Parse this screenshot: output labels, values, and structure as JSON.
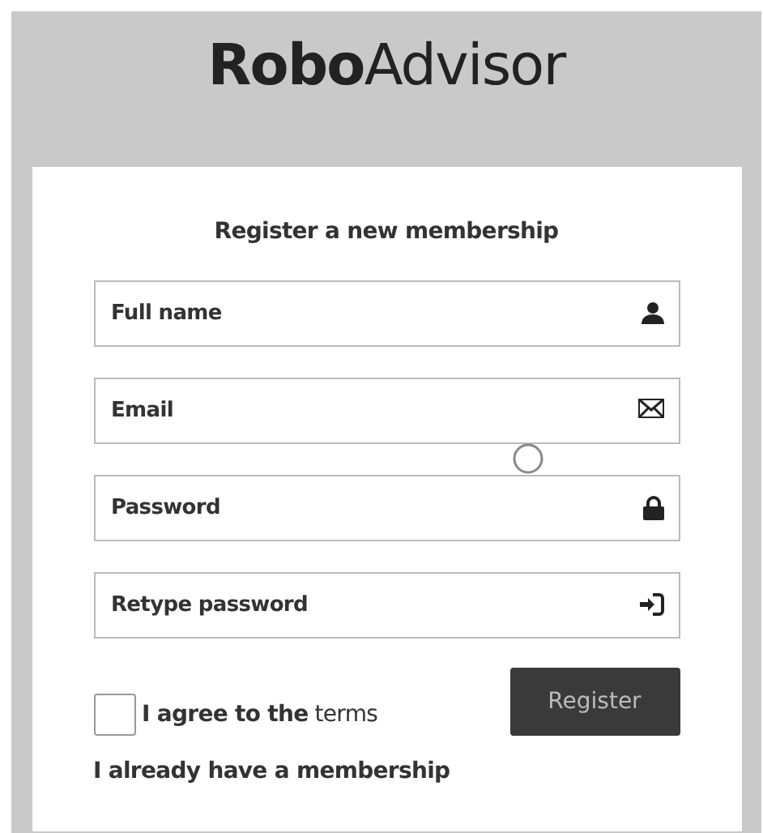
{
  "logo": "**Robo**Advisor",
  "box_title": "Register a new membership",
  "fields": [
    {
      "kind": "user",
      "placeholder": "Full name"
    },
    {
      "kind": "email",
      "placeholder": "Email"
    },
    {
      "kind": "password",
      "placeholder": "Password"
    },
    {
      "kind": "retype",
      "placeholder": "Retype password"
    }
  ],
  "agree": {
    "checked": false,
    "label": "I agree to the",
    "link": "terms"
  },
  "register_button": "Register",
  "login_link": "I already have a membership"
}
